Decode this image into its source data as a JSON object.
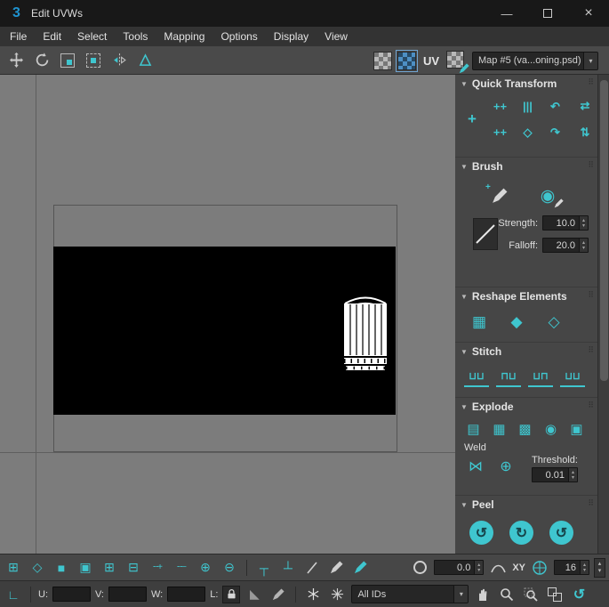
{
  "colors": {
    "accent": "#3fc6cf",
    "blue": "#2d7dbf"
  },
  "window": {
    "app_badge": "3",
    "title": "Edit UVWs",
    "minimize_glyph": "—",
    "close_glyph": "×"
  },
  "menu": {
    "items": [
      "File",
      "Edit",
      "Select",
      "Tools",
      "Mapping",
      "Options",
      "Display",
      "View"
    ]
  },
  "toolbar": {
    "uv_label": "UV",
    "map_selector_value": "Map #5 (va...oning.psd)"
  },
  "icons": {
    "section_caret": "▼",
    "grip": "⠿",
    "dropdown_caret": "▾",
    "caret_up": "▴",
    "caret_down": "▾",
    "quick_move": "+",
    "align_pair": "++",
    "align_bars": "|||",
    "rotate_ccw": "↶",
    "align_grid": "++",
    "align_diamond": "◇",
    "rotate_cw": "↷",
    "swap_h": "⇄",
    "swap_v": "⇅",
    "relax_ball": "◉",
    "reshape_grid": "▦",
    "reshape_cube_a": "◆",
    "reshape_cube_b": "◇",
    "stitch_a": "⊔⊔",
    "stitch_b": "⊓⊔",
    "stitch_c": "⊔⊓",
    "stitch_d": "⊔⊔",
    "explode_a": "▤",
    "explode_b": "▦",
    "explode_c": "▩",
    "explode_d": "◉",
    "explode_e": "▣",
    "weld_a": "⋈",
    "weld_b": "⊕",
    "peel_a": "↺",
    "peel_b": "↻",
    "peel_c": "↺",
    "soft_select": "⊞",
    "mode_vertex": "◇",
    "mode_polygon": "■",
    "mode_element": "▣",
    "grow": "⊞",
    "shrink": "⊟",
    "loop": "╌+",
    "ring": "╌−",
    "select_plus": "⊕",
    "select_minus": "⊖",
    "align_top": "┬",
    "align_bottom": "┴",
    "offset_mode": "∟",
    "wedge": "◣",
    "hook": "↺"
  },
  "panel": {
    "quick_transform": {
      "title": "Quick Transform"
    },
    "brush": {
      "title": "Brush",
      "strength_label": "Strength:",
      "strength_value": "10.0",
      "falloff_label": "Falloff:",
      "falloff_value": "20.0"
    },
    "reshape": {
      "title": "Reshape Elements"
    },
    "stitch": {
      "title": "Stitch"
    },
    "explode": {
      "title": "Explode",
      "weld_label": "Weld",
      "threshold_label": "Threshold:",
      "threshold_value": "0.01"
    },
    "peel": {
      "title": "Peel"
    }
  },
  "statusbar": {
    "soft_value": "0.0",
    "axis_label": "XY",
    "grid_value": "16",
    "u_label": "U:",
    "v_label": "V:",
    "w_label": "W:",
    "l_label": "L:",
    "u_value": "",
    "v_value": "",
    "w_value": "",
    "ids_value": "All IDs"
  }
}
